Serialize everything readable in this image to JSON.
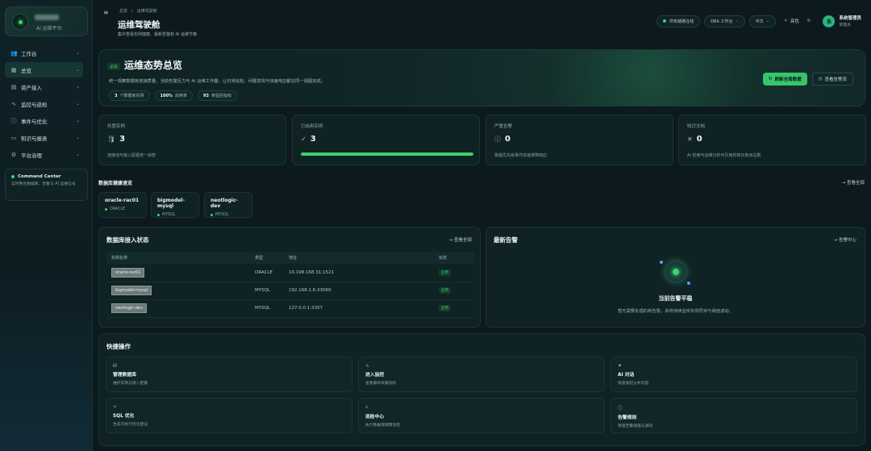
{
  "sidebar": {
    "brand_sub": "AI 运维平台",
    "items": [
      {
        "icon": "users-icon",
        "glyph": "👥",
        "label": "工作台"
      },
      {
        "icon": "grid-icon",
        "glyph": "▦",
        "label": "总览"
      },
      {
        "icon": "database-icon",
        "glyph": "▤",
        "label": "资产接入"
      },
      {
        "icon": "pulse-icon",
        "glyph": "∿",
        "label": "监控与巡检"
      },
      {
        "icon": "alert-circle-icon",
        "glyph": "ⓘ",
        "label": "事件与优化"
      },
      {
        "icon": "book-icon",
        "glyph": "▭",
        "label": "知识与报表"
      },
      {
        "icon": "settings-icon",
        "glyph": "⚙",
        "label": "平台治理"
      }
    ],
    "command_center": {
      "title": "Command Center",
      "desc": "实时整合数据库、告警与 AI 运维信号"
    }
  },
  "header": {
    "breadcrumb": [
      "总览",
      "运维驾驶舱"
    ],
    "title": "运维驾驶舱",
    "subtitle": "集中查看实例健康、最新告警和 AI 运维节奏",
    "online_status": "所有链路在线",
    "workspace": "DBA 工作台",
    "language": "中文",
    "theme": "亮色",
    "user_initial": "系",
    "user_name": "系统管理员",
    "user_role": "管理员"
  },
  "hero": {
    "tag": "总览",
    "title": "运维态势总览",
    "desc": "统一观察数据库连接质量、当前告警压力与 AI 运维工作量，让日常巡检、问题发现与快速响应都在同一视图完成。",
    "stats": [
      {
        "value": "3",
        "label": "个数据库实例"
      },
      {
        "value": "100%",
        "label": "启用率"
      },
      {
        "value": "93",
        "label": "条监控指标"
      }
    ],
    "refresh_label": "刷新全局数据",
    "alerts_label": "查看告警流"
  },
  "stats": [
    {
      "label": "托管实例",
      "icon": "database-icon",
      "glyph": "🛢",
      "value": "3",
      "note": "连接池与接入配置统一纳管"
    },
    {
      "label": "已启用实例",
      "icon": "check-circle-icon",
      "glyph": "✓",
      "value": "3",
      "progress": 1.0
    },
    {
      "label": "严重告警",
      "icon": "alert-circle-icon",
      "glyph": "ⓘ",
      "value": "0",
      "note": "按最优先级事件快速排障响应"
    },
    {
      "label": "知识文档",
      "icon": "tools-icon",
      "glyph": "✕",
      "value": "0",
      "note": "AI 检索与运维分析可引用的知识条目总数"
    }
  ],
  "db_quick": {
    "title": "数据库健康速览",
    "view_all": "查看全部",
    "items": [
      {
        "name": "oracle-rac01",
        "type": "ORACLE"
      },
      {
        "name": "bigmodel-mysql",
        "type": "MYSQL"
      },
      {
        "name": "neotlogic-dev",
        "type": "MYSQL"
      }
    ]
  },
  "db_access": {
    "title": "数据库接入状态",
    "view_all": "查看全部",
    "columns": [
      "实例名称",
      "类型",
      "地址",
      "状态"
    ],
    "rows": [
      {
        "name": "oracle-rac01",
        "type": "ORACLE",
        "addr": "10.198.168.31:1521",
        "status": "启用"
      },
      {
        "name": "bigmodel-mysql",
        "type": "MYSQL",
        "addr": "192.168.1.6:33060",
        "status": "启用"
      },
      {
        "name": "neotlogic-dev",
        "type": "MYSQL",
        "addr": "127.0.0.1:3307",
        "status": "启用"
      }
    ]
  },
  "alerts": {
    "title": "最新告警",
    "link": "告警中心",
    "empty_title": "当前告警平稳",
    "empty_desc": "暂无需要处理的新告警，系统持续监听实例异常与阈值波动。"
  },
  "quick_ops": {
    "title": "快捷操作",
    "items": [
      {
        "icon": "database-icon",
        "glyph": "⛁",
        "title": "管理数据库",
        "desc": "维护实例与接入配置"
      },
      {
        "icon": "pulse-icon",
        "glyph": "∿",
        "title": "进入监控",
        "desc": "查看最新采集指标"
      },
      {
        "icon": "bot-icon",
        "glyph": "✦",
        "title": "AI 对话",
        "desc": "快速发起分析问答"
      },
      {
        "icon": "sparkle-icon",
        "glyph": "✧",
        "title": "SQL 优化",
        "desc": "生成可执行优化建议"
      },
      {
        "icon": "search-icon",
        "glyph": "⌕",
        "title": "巡检中心",
        "desc": "执行数据库健康巡检"
      },
      {
        "icon": "alert-circle-icon",
        "glyph": "ⓘ",
        "title": "告警规则",
        "desc": "管理告警阈值与通知"
      }
    ]
  },
  "colors": {
    "accent": "#37c46a",
    "background": "#0c1a1f",
    "card": "#0f2224"
  }
}
